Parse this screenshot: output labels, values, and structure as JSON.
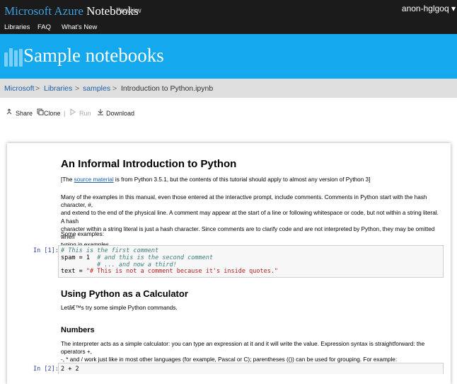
{
  "header": {
    "brand_microsoft": "Microsoft Azure",
    "brand_notebooks": "Notebooks",
    "preview": "Preview",
    "user": "anon-hglgoq ▾"
  },
  "nav": {
    "items": [
      "Libraries",
      "FAQ",
      "What's New"
    ]
  },
  "banner": {
    "title": "Sample notebooks"
  },
  "breadcrumb": {
    "items": [
      "Microsoft",
      "Libraries",
      "samples",
      "Introduction to Python.ipynb"
    ],
    "separator": ">"
  },
  "toolbar": {
    "share": "Share",
    "clone": "Clone",
    "divider": "|",
    "run": "Run",
    "download": "Download"
  },
  "notebook": {
    "title": "An Informal Introduction to Python",
    "source_prefix": "[The ",
    "source_link": "source material",
    "source_suffix": " is from Python 3.5.1, but the contents of this tutorial should apply to almost any version of Python 3]",
    "para1": [
      "Many of the examples in this manual, even those entered at the interactive prompt, include comments. Comments in Python start with the hash character, #,",
      "and extend to the end of the physical line. A comment may appear at the start of a line or following whitespace or code, but not within a string literal. A hash",
      "character within a string literal is just a hash character. Since comments are to clarify code and are not interpreted by Python, they may be omitted when",
      "typing in examples."
    ],
    "some_examples": "Some examples:",
    "cell1": {
      "prompt": "In [1]:",
      "line1_comment": "# This is the first comment",
      "line2_code": "spam = 1  ",
      "line2_comment": "# and this is the second comment",
      "line3_comment": "          # ... and now a third!",
      "line4_code": "text = ",
      "line4_string": "\"# This is not a comment because it's inside quotes.\""
    },
    "h2": "Using Python as a Calculator",
    "lets_try": "Letâ€™s try some simple Python commands.",
    "h3": "Numbers",
    "para2": [
      "The interpreter acts as a simple calculator: you can type an expression at it and it will write the value. Expression syntax is straightforward: the operators +,",
      "-, * and / work just like in most other languages (for example, Pascal or C); parentheses (()) can be used for grouping. For example:"
    ],
    "cell2": {
      "prompt": "In [2]:",
      "code": "2 + 2"
    }
  },
  "colors": {
    "topbar": "#1b1b1b",
    "banner": "#14a9ee",
    "brand_blue": "#3aa0dd",
    "link": "#1a5fa8",
    "prompt": "#303f9f",
    "comment": "#408080",
    "string": "#ba2121"
  }
}
